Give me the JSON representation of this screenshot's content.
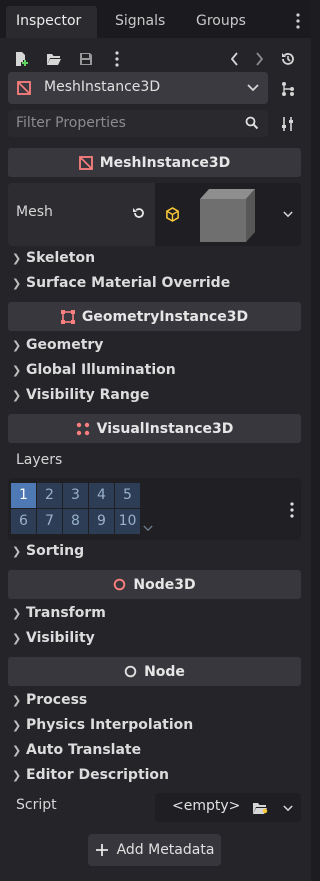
{
  "tabs": [
    {
      "label": "Inspector",
      "active": true
    },
    {
      "label": "Signals",
      "active": false
    },
    {
      "label": "Groups",
      "active": false
    }
  ],
  "toolbar": {
    "icons": [
      "new-resource-icon",
      "load-resource-icon",
      "save-icon",
      "more-icon",
      "history-back-icon",
      "history-forward-icon",
      "history-icon"
    ]
  },
  "object_selector": {
    "value": "MeshInstance3D"
  },
  "filter": {
    "placeholder": "Filter Properties"
  },
  "sections": {
    "mesh_instance": {
      "title": "MeshInstance3D",
      "mesh_label": "Mesh",
      "groups": [
        "Skeleton",
        "Surface Material Override"
      ]
    },
    "geometry_instance": {
      "title": "GeometryInstance3D",
      "groups": [
        "Geometry",
        "Global Illumination",
        "Visibility Range"
      ]
    },
    "visual_instance": {
      "title": "VisualInstance3D",
      "layers_label": "Layers",
      "layers": [
        "1",
        "2",
        "3",
        "4",
        "5",
        "6",
        "7",
        "8",
        "9",
        "10"
      ],
      "layers_enabled": [
        "1"
      ],
      "groups": [
        "Sorting"
      ]
    },
    "node3d": {
      "title": "Node3D",
      "groups": [
        "Transform",
        "Visibility"
      ]
    },
    "node": {
      "title": "Node",
      "groups": [
        "Process",
        "Physics Interpolation",
        "Auto Translate",
        "Editor Description"
      ],
      "script_label": "Script",
      "script_value": "<empty>"
    }
  },
  "add_metadata": {
    "label": "Add Metadata"
  },
  "colors": {
    "accent_red": "#fc7f7f",
    "layer_on": "#4f79b4",
    "layer_off": "#2c3d55",
    "mesh_yellow": "#ffca38"
  }
}
